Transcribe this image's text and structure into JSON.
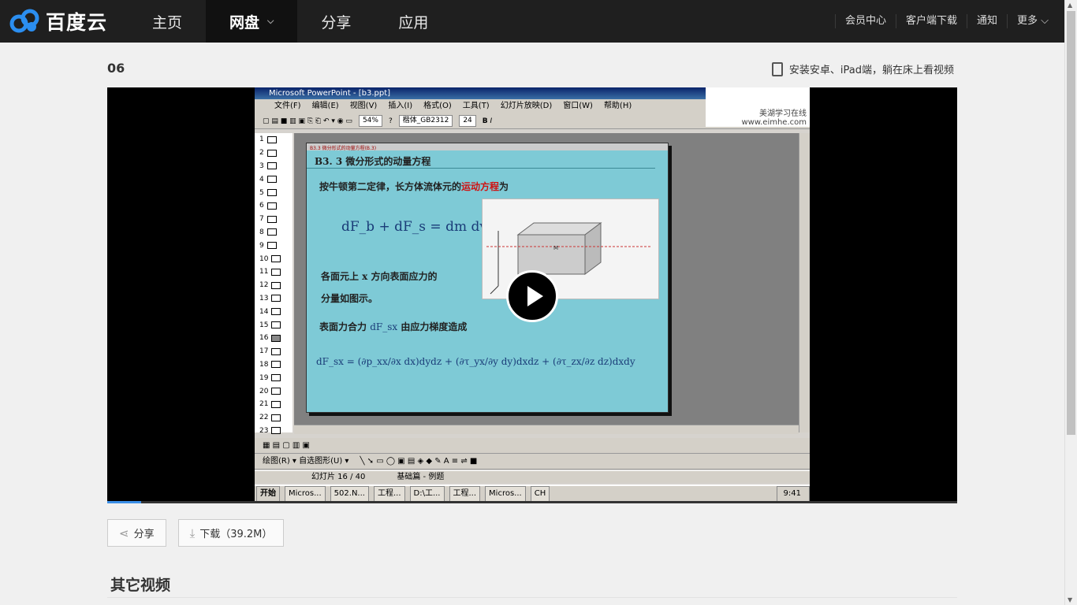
{
  "brand": {
    "logo_text": "百度云",
    "logo_icon": "cloud-icon"
  },
  "nav": {
    "items": [
      {
        "label": "主页",
        "active": false
      },
      {
        "label": "网盘",
        "active": true
      },
      {
        "label": "分享",
        "active": false
      },
      {
        "label": "应用",
        "active": false
      }
    ]
  },
  "toplinks": {
    "vip": "会员中心",
    "client": "客户端下载",
    "notify": "通知",
    "more": "更多"
  },
  "video": {
    "title": "06",
    "promo": "安装安卓、iPad端，躺在床上看视频",
    "play_icon": "play-icon",
    "progress_fraction": 0.04
  },
  "screen": {
    "window_title": "Microsoft PowerPoint - [b3.ppt]",
    "menu": [
      "文件(F)",
      "编辑(E)",
      "视图(V)",
      "插入(I)",
      "格式(O)",
      "工具(T)",
      "幻灯片放映(D)",
      "窗口(W)",
      "帮助(H)"
    ],
    "zoom": "54%",
    "font": "楷体_GB2312",
    "font_size": "24",
    "watermark": "美湖学习在线 www.eimhe.com",
    "slide_numbers": [
      "1",
      "2",
      "3",
      "4",
      "5",
      "6",
      "7",
      "8",
      "9",
      "10",
      "11",
      "12",
      "13",
      "14",
      "15",
      "16",
      "17",
      "18",
      "19",
      "20",
      "21",
      "22",
      "23"
    ],
    "slide_header": "B3.3 微分形式的动量方程(B.3)",
    "slide_title": "B3. 3  微分形式的动量方程",
    "line1_a": "按牛顿第二定律，长方体流体元的",
    "line1_b": "运动方程",
    "line1_c": "为",
    "eq1": "dF_b + dF_s = dm dv/dt",
    "line2": "各面元上 x 方向表面应力的",
    "line3": "分量如图示。",
    "line4_a": "表面力合力",
    "line4_b": "dF_sx",
    "line4_c": "由应力梯度造成",
    "eq2": "dF_sx = (∂p_xx/∂x dx)dydz + (∂τ_yx/∂y dy)dxdz + (∂τ_zx/∂z dz)dxdy",
    "draw_toolbar": "绘图(R) ▾    自选图形(U) ▾",
    "status_slide": "幻灯片 16 / 40",
    "status_design": "基础篇 - 例题",
    "taskbar_start": "开始",
    "taskbar_items": [
      "Micros...",
      "502.N...",
      "工程...",
      "D:\\工...",
      "工程...",
      "Micros..."
    ],
    "taskbar_lang": "CH",
    "clock": "9:41"
  },
  "actions": {
    "share": "分享",
    "download": "下载（39.2M）"
  },
  "section": {
    "title": "其它视频"
  }
}
